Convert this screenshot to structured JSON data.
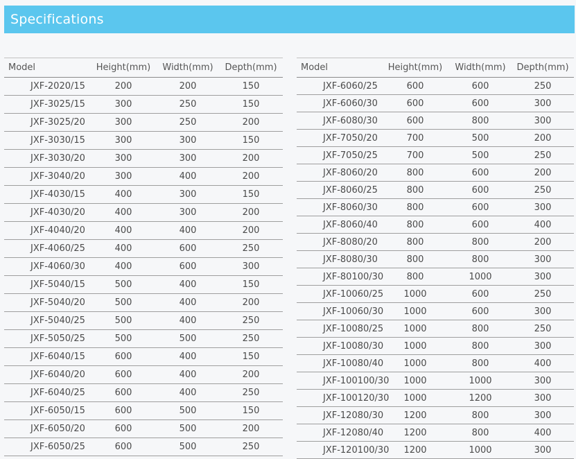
{
  "header": {
    "title": "Specifications"
  },
  "columns": [
    "Model",
    "Height(mm)",
    "Width(mm)",
    "Depth(mm)"
  ],
  "left_rows": [
    [
      "JXF-2020/15",
      "200",
      "200",
      "150"
    ],
    [
      "JXF-3025/15",
      "300",
      "250",
      "150"
    ],
    [
      "JXF-3025/20",
      "300",
      "250",
      "200"
    ],
    [
      "JXF-3030/15",
      "300",
      "300",
      "150"
    ],
    [
      "JXF-3030/20",
      "300",
      "300",
      "200"
    ],
    [
      "JXF-3040/20",
      "300",
      "400",
      "200"
    ],
    [
      "JXF-4030/15",
      "400",
      "300",
      "150"
    ],
    [
      "JXF-4030/20",
      "400",
      "300",
      "200"
    ],
    [
      "JXF-4040/20",
      "400",
      "400",
      "200"
    ],
    [
      "JXF-4060/25",
      "400",
      "600",
      "250"
    ],
    [
      "JXF-4060/30",
      "400",
      "600",
      "300"
    ],
    [
      "JXF-5040/15",
      "500",
      "400",
      "150"
    ],
    [
      "JXF-5040/20",
      "500",
      "400",
      "200"
    ],
    [
      "JXF-5040/25",
      "500",
      "400",
      "250"
    ],
    [
      "JXF-5050/25",
      "500",
      "500",
      "250"
    ],
    [
      "JXF-6040/15",
      "600",
      "400",
      "150"
    ],
    [
      "JXF-6040/20",
      "600",
      "400",
      "200"
    ],
    [
      "JXF-6040/25",
      "600",
      "400",
      "250"
    ],
    [
      "JXF-6050/15",
      "600",
      "500",
      "150"
    ],
    [
      "JXF-6050/20",
      "600",
      "500",
      "200"
    ],
    [
      "JXF-6050/25",
      "600",
      "500",
      "250"
    ]
  ],
  "right_rows": [
    [
      "JXF-6060/25",
      "600",
      "600",
      "250"
    ],
    [
      "JXF-6060/30",
      "600",
      "600",
      "300"
    ],
    [
      "JXF-6080/30",
      "600",
      "800",
      "300"
    ],
    [
      "JXF-7050/20",
      "700",
      "500",
      "200"
    ],
    [
      "JXF-7050/25",
      "700",
      "500",
      "250"
    ],
    [
      "JXF-8060/20",
      "800",
      "600",
      "200"
    ],
    [
      "JXF-8060/25",
      "800",
      "600",
      "250"
    ],
    [
      "JXF-8060/30",
      "800",
      "600",
      "300"
    ],
    [
      "JXF-8060/40",
      "800",
      "600",
      "400"
    ],
    [
      "JXF-8080/20",
      "800",
      "800",
      "200"
    ],
    [
      "JXF-8080/30",
      "800",
      "800",
      "300"
    ],
    [
      "JXF-80100/30",
      "800",
      "1000",
      "300"
    ],
    [
      "JXF-10060/25",
      "1000",
      "600",
      "250"
    ],
    [
      "JXF-10060/30",
      "1000",
      "600",
      "300"
    ],
    [
      "JXF-10080/25",
      "1000",
      "800",
      "250"
    ],
    [
      "JXF-10080/30",
      "1000",
      "800",
      "300"
    ],
    [
      "JXF-10080/40",
      "1000",
      "800",
      "400"
    ],
    [
      "JXF-100100/30",
      "1000",
      "1000",
      "300"
    ],
    [
      "JXF-100120/30",
      "1000",
      "1200",
      "300"
    ],
    [
      "JXF-12080/30",
      "1200",
      "800",
      "300"
    ],
    [
      "JXF-12080/40",
      "1200",
      "800",
      "400"
    ],
    [
      "JXF-120100/30",
      "1200",
      "1000",
      "300"
    ]
  ]
}
